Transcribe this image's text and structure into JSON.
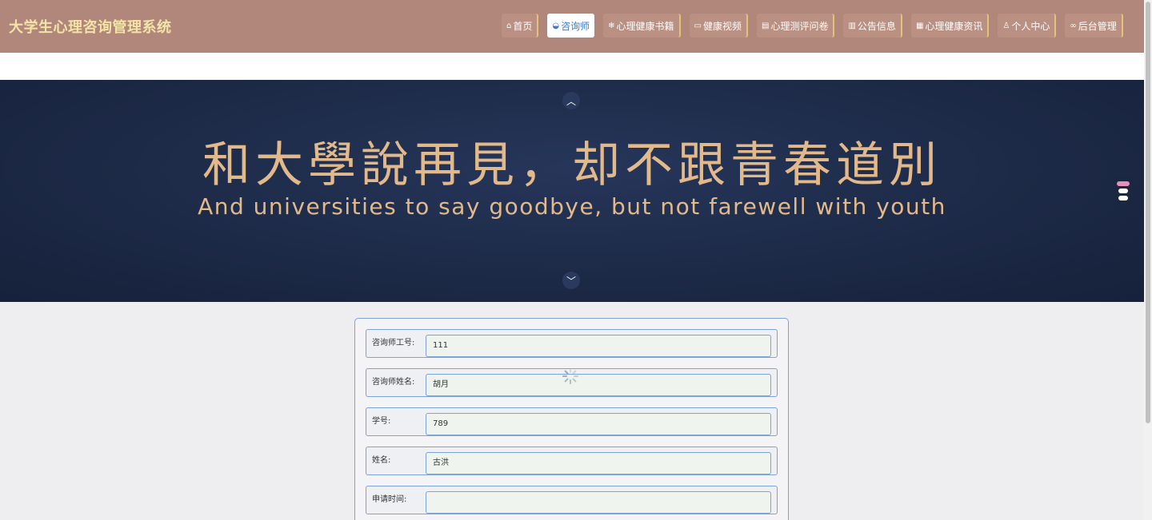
{
  "header": {
    "site_title": "大学生心理咨询管理系统",
    "nav": [
      {
        "icon": "home-icon",
        "glyph": "⌂",
        "label": "首页",
        "active": false
      },
      {
        "icon": "graduation-cap-icon",
        "glyph": "◒",
        "label": "咨询师",
        "active": true
      },
      {
        "icon": "snowflake-icon",
        "glyph": "❄",
        "label": "心理健康书籍",
        "active": false
      },
      {
        "icon": "book-icon",
        "glyph": "▭",
        "label": "健康视频",
        "active": false
      },
      {
        "icon": "document-icon",
        "glyph": "▤",
        "label": "心理测评问卷",
        "active": false
      },
      {
        "icon": "notice-icon",
        "glyph": "▥",
        "label": "公告信息",
        "active": false
      },
      {
        "icon": "news-icon",
        "glyph": "▦",
        "label": "心理健康资讯",
        "active": false
      },
      {
        "icon": "user-icon",
        "glyph": "♙",
        "label": "个人中心",
        "active": false
      },
      {
        "icon": "link-icon",
        "glyph": "∞",
        "label": "后台管理",
        "active": false
      }
    ]
  },
  "banner": {
    "title": "和大學說再見，却不跟青春道別",
    "subtitle": "And universities to say goodbye, but not farewell with youth"
  },
  "form": {
    "fields": [
      {
        "label": "咨询师工号:",
        "value": "111"
      },
      {
        "label": "咨询师姓名:",
        "value": "胡月"
      },
      {
        "label": "学号:",
        "value": "789"
      },
      {
        "label": "姓名:",
        "value": "古洪"
      },
      {
        "label": "申请时间:",
        "value": ""
      }
    ]
  }
}
